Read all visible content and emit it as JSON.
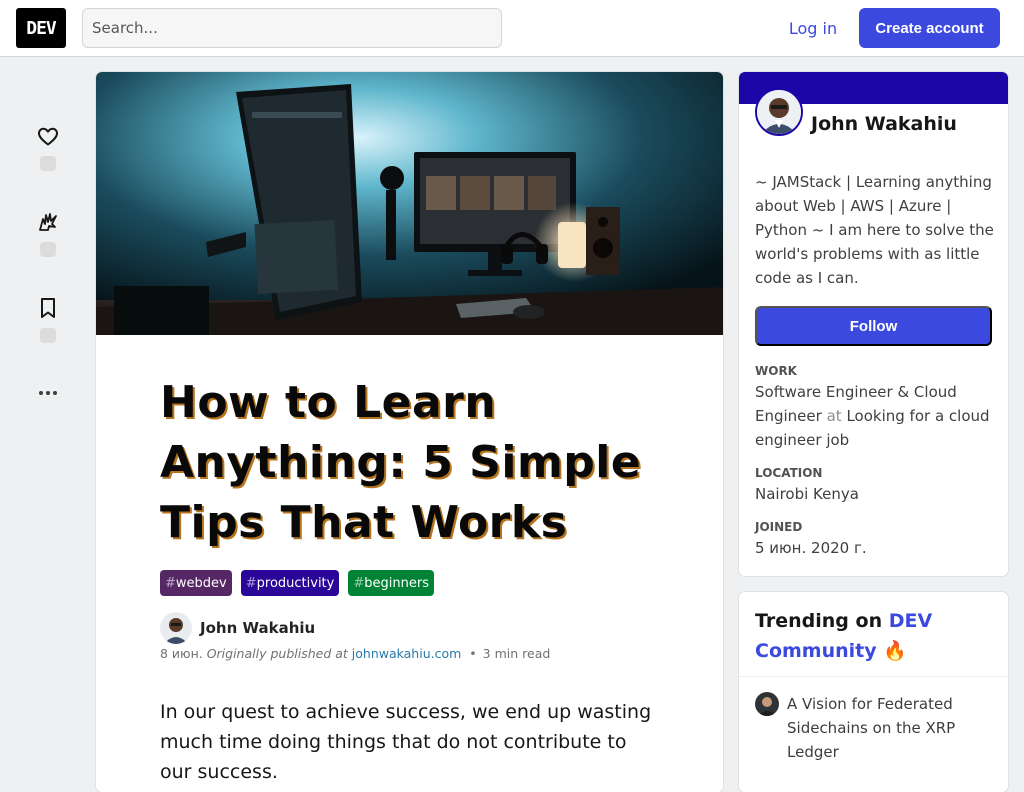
{
  "header": {
    "logo_text": "DEV",
    "search_placeholder": "Search...",
    "login_label": "Log in",
    "create_account_label": "Create account"
  },
  "reactions": {
    "heart_icon": "heart-icon",
    "unicorn_icon": "unicorn-icon",
    "bookmark_icon": "bookmark-icon",
    "more_icon": "more-icon"
  },
  "article": {
    "title": "How to Learn Anything: 5 Simple Tips That Works",
    "tags": [
      {
        "name": "webdev",
        "color": "#562765"
      },
      {
        "name": "productivity",
        "color": "#2a0798"
      },
      {
        "name": "beginners",
        "color": "#008335"
      }
    ],
    "author": "John Wakahiu",
    "date": "8 июн.",
    "originally_published": "Originally published at",
    "source_link": "johnwakahiu.com",
    "read_time": "3 min read",
    "intro": "In our quest to achieve success, we end up wasting much time doing things that do not contribute to our success."
  },
  "profile": {
    "name": "John Wakahiu",
    "bio": "~ JAMStack | Learning anything about Web | AWS | Azure | Python ~ I am here to solve the world's problems with as little code as I can.",
    "follow_label": "Follow",
    "work_label": "WORK",
    "work_role": "Software Engineer & Cloud Engineer",
    "work_at": "at",
    "work_company": "Looking for a cloud engineer job",
    "location_label": "LOCATION",
    "location": "Nairobi Kenya",
    "joined_label": "JOINED",
    "joined": "5 июн. 2020 г.",
    "brand_color": "#1e05a7"
  },
  "trending": {
    "heading_prefix": "Trending on",
    "heading_brand": "DEV Community",
    "emoji": "🔥",
    "items": [
      {
        "title": "A Vision for Federated Sidechains on the XRP Ledger"
      }
    ]
  },
  "colors": {
    "accent": "#3b49df",
    "background": "#eef0f1"
  }
}
